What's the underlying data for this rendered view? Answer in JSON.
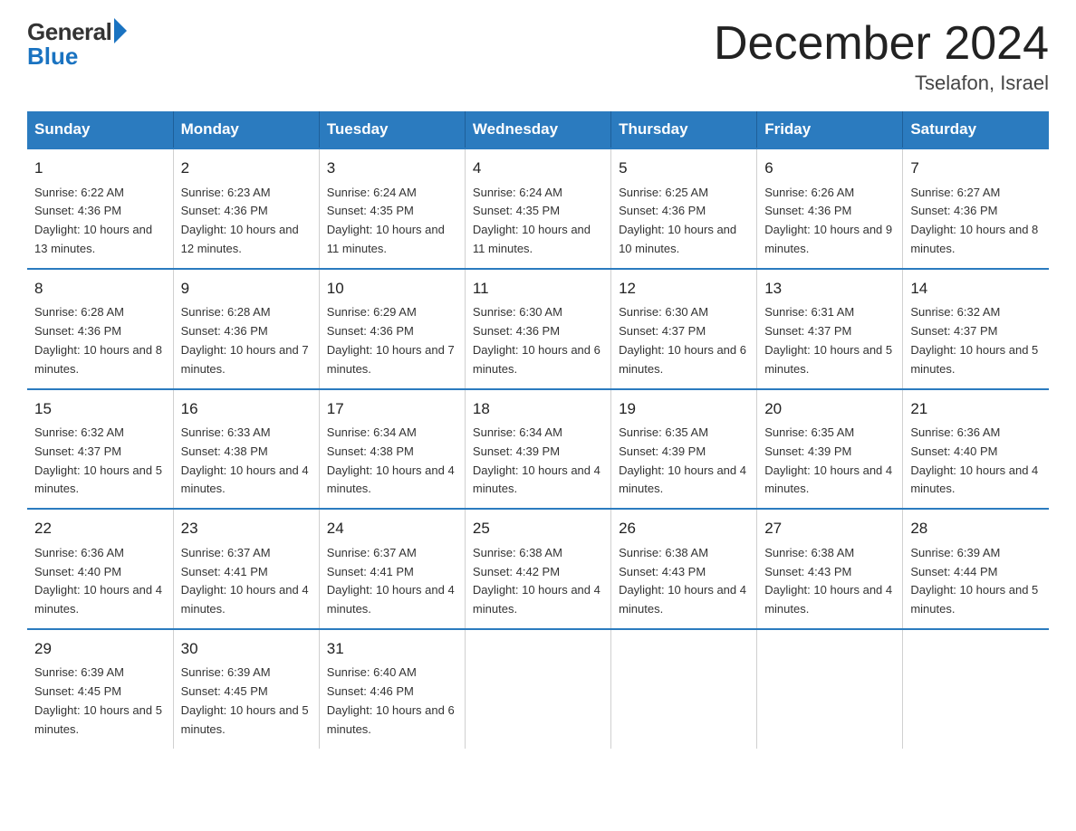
{
  "header": {
    "logo_general": "General",
    "logo_blue": "Blue",
    "month_title": "December 2024",
    "location": "Tselafon, Israel"
  },
  "days_of_week": [
    "Sunday",
    "Monday",
    "Tuesday",
    "Wednesday",
    "Thursday",
    "Friday",
    "Saturday"
  ],
  "weeks": [
    [
      {
        "day": "1",
        "sunrise": "6:22 AM",
        "sunset": "4:36 PM",
        "daylight": "10 hours and 13 minutes."
      },
      {
        "day": "2",
        "sunrise": "6:23 AM",
        "sunset": "4:36 PM",
        "daylight": "10 hours and 12 minutes."
      },
      {
        "day": "3",
        "sunrise": "6:24 AM",
        "sunset": "4:35 PM",
        "daylight": "10 hours and 11 minutes."
      },
      {
        "day": "4",
        "sunrise": "6:24 AM",
        "sunset": "4:35 PM",
        "daylight": "10 hours and 11 minutes."
      },
      {
        "day": "5",
        "sunrise": "6:25 AM",
        "sunset": "4:36 PM",
        "daylight": "10 hours and 10 minutes."
      },
      {
        "day": "6",
        "sunrise": "6:26 AM",
        "sunset": "4:36 PM",
        "daylight": "10 hours and 9 minutes."
      },
      {
        "day": "7",
        "sunrise": "6:27 AM",
        "sunset": "4:36 PM",
        "daylight": "10 hours and 8 minutes."
      }
    ],
    [
      {
        "day": "8",
        "sunrise": "6:28 AM",
        "sunset": "4:36 PM",
        "daylight": "10 hours and 8 minutes."
      },
      {
        "day": "9",
        "sunrise": "6:28 AM",
        "sunset": "4:36 PM",
        "daylight": "10 hours and 7 minutes."
      },
      {
        "day": "10",
        "sunrise": "6:29 AM",
        "sunset": "4:36 PM",
        "daylight": "10 hours and 7 minutes."
      },
      {
        "day": "11",
        "sunrise": "6:30 AM",
        "sunset": "4:36 PM",
        "daylight": "10 hours and 6 minutes."
      },
      {
        "day": "12",
        "sunrise": "6:30 AM",
        "sunset": "4:37 PM",
        "daylight": "10 hours and 6 minutes."
      },
      {
        "day": "13",
        "sunrise": "6:31 AM",
        "sunset": "4:37 PM",
        "daylight": "10 hours and 5 minutes."
      },
      {
        "day": "14",
        "sunrise": "6:32 AM",
        "sunset": "4:37 PM",
        "daylight": "10 hours and 5 minutes."
      }
    ],
    [
      {
        "day": "15",
        "sunrise": "6:32 AM",
        "sunset": "4:37 PM",
        "daylight": "10 hours and 5 minutes."
      },
      {
        "day": "16",
        "sunrise": "6:33 AM",
        "sunset": "4:38 PM",
        "daylight": "10 hours and 4 minutes."
      },
      {
        "day": "17",
        "sunrise": "6:34 AM",
        "sunset": "4:38 PM",
        "daylight": "10 hours and 4 minutes."
      },
      {
        "day": "18",
        "sunrise": "6:34 AM",
        "sunset": "4:39 PM",
        "daylight": "10 hours and 4 minutes."
      },
      {
        "day": "19",
        "sunrise": "6:35 AM",
        "sunset": "4:39 PM",
        "daylight": "10 hours and 4 minutes."
      },
      {
        "day": "20",
        "sunrise": "6:35 AM",
        "sunset": "4:39 PM",
        "daylight": "10 hours and 4 minutes."
      },
      {
        "day": "21",
        "sunrise": "6:36 AM",
        "sunset": "4:40 PM",
        "daylight": "10 hours and 4 minutes."
      }
    ],
    [
      {
        "day": "22",
        "sunrise": "6:36 AM",
        "sunset": "4:40 PM",
        "daylight": "10 hours and 4 minutes."
      },
      {
        "day": "23",
        "sunrise": "6:37 AM",
        "sunset": "4:41 PM",
        "daylight": "10 hours and 4 minutes."
      },
      {
        "day": "24",
        "sunrise": "6:37 AM",
        "sunset": "4:41 PM",
        "daylight": "10 hours and 4 minutes."
      },
      {
        "day": "25",
        "sunrise": "6:38 AM",
        "sunset": "4:42 PM",
        "daylight": "10 hours and 4 minutes."
      },
      {
        "day": "26",
        "sunrise": "6:38 AM",
        "sunset": "4:43 PM",
        "daylight": "10 hours and 4 minutes."
      },
      {
        "day": "27",
        "sunrise": "6:38 AM",
        "sunset": "4:43 PM",
        "daylight": "10 hours and 4 minutes."
      },
      {
        "day": "28",
        "sunrise": "6:39 AM",
        "sunset": "4:44 PM",
        "daylight": "10 hours and 5 minutes."
      }
    ],
    [
      {
        "day": "29",
        "sunrise": "6:39 AM",
        "sunset": "4:45 PM",
        "daylight": "10 hours and 5 minutes."
      },
      {
        "day": "30",
        "sunrise": "6:39 AM",
        "sunset": "4:45 PM",
        "daylight": "10 hours and 5 minutes."
      },
      {
        "day": "31",
        "sunrise": "6:40 AM",
        "sunset": "4:46 PM",
        "daylight": "10 hours and 6 minutes."
      },
      null,
      null,
      null,
      null
    ]
  ]
}
